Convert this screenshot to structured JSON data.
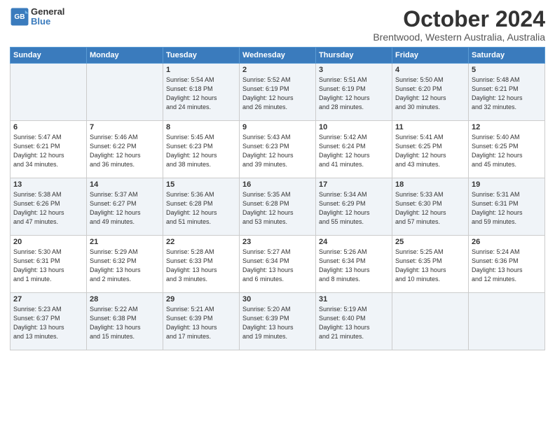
{
  "logo": {
    "line1": "General",
    "line2": "Blue"
  },
  "title": "October 2024",
  "subtitle": "Brentwood, Western Australia, Australia",
  "days_of_week": [
    "Sunday",
    "Monday",
    "Tuesday",
    "Wednesday",
    "Thursday",
    "Friday",
    "Saturday"
  ],
  "weeks": [
    [
      {
        "day": "",
        "info": ""
      },
      {
        "day": "",
        "info": ""
      },
      {
        "day": "1",
        "info": "Sunrise: 5:54 AM\nSunset: 6:18 PM\nDaylight: 12 hours\nand 24 minutes."
      },
      {
        "day": "2",
        "info": "Sunrise: 5:52 AM\nSunset: 6:19 PM\nDaylight: 12 hours\nand 26 minutes."
      },
      {
        "day": "3",
        "info": "Sunrise: 5:51 AM\nSunset: 6:19 PM\nDaylight: 12 hours\nand 28 minutes."
      },
      {
        "day": "4",
        "info": "Sunrise: 5:50 AM\nSunset: 6:20 PM\nDaylight: 12 hours\nand 30 minutes."
      },
      {
        "day": "5",
        "info": "Sunrise: 5:48 AM\nSunset: 6:21 PM\nDaylight: 12 hours\nand 32 minutes."
      }
    ],
    [
      {
        "day": "6",
        "info": "Sunrise: 5:47 AM\nSunset: 6:21 PM\nDaylight: 12 hours\nand 34 minutes."
      },
      {
        "day": "7",
        "info": "Sunrise: 5:46 AM\nSunset: 6:22 PM\nDaylight: 12 hours\nand 36 minutes."
      },
      {
        "day": "8",
        "info": "Sunrise: 5:45 AM\nSunset: 6:23 PM\nDaylight: 12 hours\nand 38 minutes."
      },
      {
        "day": "9",
        "info": "Sunrise: 5:43 AM\nSunset: 6:23 PM\nDaylight: 12 hours\nand 39 minutes."
      },
      {
        "day": "10",
        "info": "Sunrise: 5:42 AM\nSunset: 6:24 PM\nDaylight: 12 hours\nand 41 minutes."
      },
      {
        "day": "11",
        "info": "Sunrise: 5:41 AM\nSunset: 6:25 PM\nDaylight: 12 hours\nand 43 minutes."
      },
      {
        "day": "12",
        "info": "Sunrise: 5:40 AM\nSunset: 6:25 PM\nDaylight: 12 hours\nand 45 minutes."
      }
    ],
    [
      {
        "day": "13",
        "info": "Sunrise: 5:38 AM\nSunset: 6:26 PM\nDaylight: 12 hours\nand 47 minutes."
      },
      {
        "day": "14",
        "info": "Sunrise: 5:37 AM\nSunset: 6:27 PM\nDaylight: 12 hours\nand 49 minutes."
      },
      {
        "day": "15",
        "info": "Sunrise: 5:36 AM\nSunset: 6:28 PM\nDaylight: 12 hours\nand 51 minutes."
      },
      {
        "day": "16",
        "info": "Sunrise: 5:35 AM\nSunset: 6:28 PM\nDaylight: 12 hours\nand 53 minutes."
      },
      {
        "day": "17",
        "info": "Sunrise: 5:34 AM\nSunset: 6:29 PM\nDaylight: 12 hours\nand 55 minutes."
      },
      {
        "day": "18",
        "info": "Sunrise: 5:33 AM\nSunset: 6:30 PM\nDaylight: 12 hours\nand 57 minutes."
      },
      {
        "day": "19",
        "info": "Sunrise: 5:31 AM\nSunset: 6:31 PM\nDaylight: 12 hours\nand 59 minutes."
      }
    ],
    [
      {
        "day": "20",
        "info": "Sunrise: 5:30 AM\nSunset: 6:31 PM\nDaylight: 13 hours\nand 1 minute."
      },
      {
        "day": "21",
        "info": "Sunrise: 5:29 AM\nSunset: 6:32 PM\nDaylight: 13 hours\nand 2 minutes."
      },
      {
        "day": "22",
        "info": "Sunrise: 5:28 AM\nSunset: 6:33 PM\nDaylight: 13 hours\nand 3 minutes."
      },
      {
        "day": "23",
        "info": "Sunrise: 5:27 AM\nSunset: 6:34 PM\nDaylight: 13 hours\nand 6 minutes."
      },
      {
        "day": "24",
        "info": "Sunrise: 5:26 AM\nSunset: 6:34 PM\nDaylight: 13 hours\nand 8 minutes."
      },
      {
        "day": "25",
        "info": "Sunrise: 5:25 AM\nSunset: 6:35 PM\nDaylight: 13 hours\nand 10 minutes."
      },
      {
        "day": "26",
        "info": "Sunrise: 5:24 AM\nSunset: 6:36 PM\nDaylight: 13 hours\nand 12 minutes."
      }
    ],
    [
      {
        "day": "27",
        "info": "Sunrise: 5:23 AM\nSunset: 6:37 PM\nDaylight: 13 hours\nand 13 minutes."
      },
      {
        "day": "28",
        "info": "Sunrise: 5:22 AM\nSunset: 6:38 PM\nDaylight: 13 hours\nand 15 minutes."
      },
      {
        "day": "29",
        "info": "Sunrise: 5:21 AM\nSunset: 6:39 PM\nDaylight: 13 hours\nand 17 minutes."
      },
      {
        "day": "30",
        "info": "Sunrise: 5:20 AM\nSunset: 6:39 PM\nDaylight: 13 hours\nand 19 minutes."
      },
      {
        "day": "31",
        "info": "Sunrise: 5:19 AM\nSunset: 6:40 PM\nDaylight: 13 hours\nand 21 minutes."
      },
      {
        "day": "",
        "info": ""
      },
      {
        "day": "",
        "info": ""
      }
    ]
  ]
}
